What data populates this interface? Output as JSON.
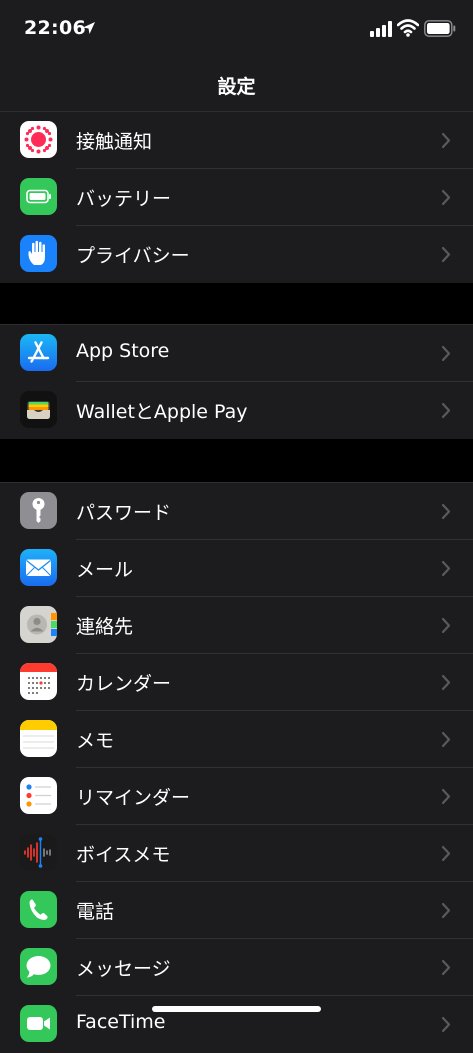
{
  "status_bar": {
    "time": "22:06"
  },
  "nav": {
    "title": "設定"
  },
  "groups": [
    {
      "items": [
        {
          "label": "接触通知",
          "icon": "exposure-notification-icon"
        },
        {
          "label": "バッテリー",
          "icon": "battery-icon"
        },
        {
          "label": "プライバシー",
          "icon": "privacy-hand-icon"
        }
      ]
    },
    {
      "items": [
        {
          "label": "App Store",
          "icon": "app-store-icon"
        },
        {
          "label": "WalletとApple Pay",
          "icon": "wallet-icon"
        }
      ]
    },
    {
      "items": [
        {
          "label": "パスワード",
          "icon": "key-icon"
        },
        {
          "label": "メール",
          "icon": "mail-icon"
        },
        {
          "label": "連絡先",
          "icon": "contacts-icon"
        },
        {
          "label": "カレンダー",
          "icon": "calendar-icon"
        },
        {
          "label": "メモ",
          "icon": "notes-icon"
        },
        {
          "label": "リマインダー",
          "icon": "reminders-icon"
        },
        {
          "label": "ボイスメモ",
          "icon": "voice-memos-icon"
        },
        {
          "label": "電話",
          "icon": "phone-icon"
        },
        {
          "label": "メッセージ",
          "icon": "messages-icon"
        },
        {
          "label": "FaceTime",
          "icon": "facetime-icon"
        }
      ]
    }
  ],
  "colors": {
    "background": "#000000",
    "cell": "#1c1c1e",
    "separator": "#323234",
    "chevron": "#5a5a5e",
    "accent_blue": "#1a82fb",
    "accent_green": "#34c759"
  }
}
